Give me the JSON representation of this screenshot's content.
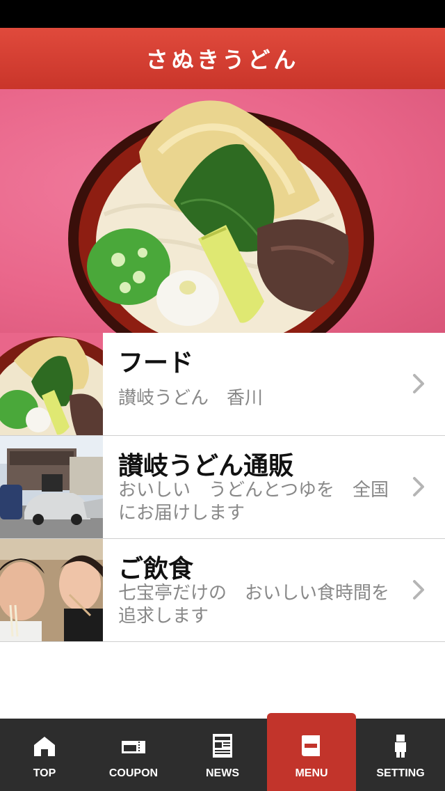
{
  "header": {
    "title": "さぬきうどん"
  },
  "menu_items": [
    {
      "title": "フード",
      "description": "讃岐うどん　香川"
    },
    {
      "title": "讃岐うどん通販",
      "description": "おいしい　うどんとつゆを　全国にお届けします"
    },
    {
      "title": "ご飲食",
      "description": "七宝亭だけの　おいしい食時間を　追求します"
    }
  ],
  "tabs": [
    {
      "label": "TOP",
      "icon": "home-icon"
    },
    {
      "label": "COUPON",
      "icon": "coupon-icon"
    },
    {
      "label": "NEWS",
      "icon": "newspaper-icon"
    },
    {
      "label": "MENU",
      "icon": "menu-book-icon",
      "active": true
    },
    {
      "label": "SETTING",
      "icon": "person-icon"
    }
  ],
  "colors": {
    "brand_red": "#c9352a",
    "tab_bar": "#2d2d2d",
    "hero_pink": "#e9668a"
  }
}
